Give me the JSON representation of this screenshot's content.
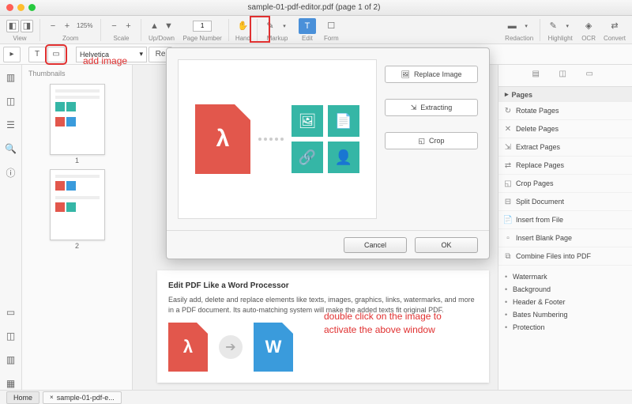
{
  "window": {
    "title": "sample-01-pdf-editor.pdf (page 1 of 2)"
  },
  "toolbar": {
    "view": "View",
    "zoom": "Zoom",
    "zoom_pct": "125%",
    "scale": "Scale",
    "updown": "Up/Down",
    "page_number": "Page Number",
    "page_val": "1",
    "hand": "Hand",
    "markup": "Markup",
    "edit": "Edit",
    "form": "Form",
    "redaction": "Redaction",
    "highlight": "Highlight",
    "ocr": "OCR",
    "convert": "Convert"
  },
  "subbar": {
    "font": "Helvetica",
    "font_caret": "▾",
    "re": "Re"
  },
  "thumbs": {
    "title": "Thumbnails",
    "p1": "1",
    "p2": "2"
  },
  "modal": {
    "replace_image": "Replace Image",
    "extracting": "Extracting",
    "crop": "Crop",
    "cancel": "Cancel",
    "ok": "OK"
  },
  "doc": {
    "heading": "Edit PDF Like a Word Processor",
    "body": "Easily add, delete and replace elements like texts, images, graphics, links, watermarks, and more in a PDF document. Its auto-matching system will make the added texts fit original PDF."
  },
  "annotations": {
    "add_image": "add image",
    "double_click": "double click on the image to activate the above window"
  },
  "right": {
    "pages": "Pages",
    "rotate": "Rotate Pages",
    "delete": "Delete Pages",
    "extract": "Extract Pages",
    "replace": "Replace Pages",
    "crop": "Crop Pages",
    "split": "Split Document",
    "insert_file": "Insert from File",
    "insert_blank": "Insert Blank Page",
    "combine": "Combine Files into PDF",
    "watermark": "Watermark",
    "background": "Background",
    "header_footer": "Header & Footer",
    "bates": "Bates Numbering",
    "protection": "Protection"
  },
  "status": {
    "home": "Home",
    "tab1": "sample-01-pdf-e...",
    "close": "×"
  }
}
